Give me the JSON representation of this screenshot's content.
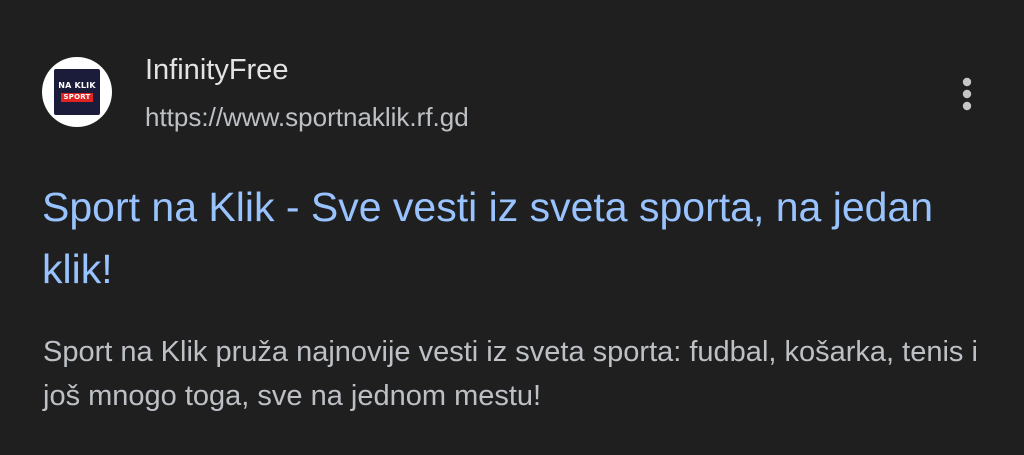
{
  "result": {
    "site_logo": {
      "line1": "NA KLIK",
      "line2": "SPORT",
      "background_color": "#1b1c3a",
      "badge_color": "#e02424"
    },
    "site_name": "InfinityFree",
    "url": "https://www.sportnaklik.rf.gd",
    "more_icon": "more-vert-icon",
    "title": "Sport na Klik - Sve vesti iz sveta sporta, na jedan klik!",
    "snippet": "Sport na Klik pruža najnovije vesti iz sveta sporta: fudbal, košarka, tenis i još mnogo toga, sve na jednom mestu!"
  },
  "colors": {
    "background": "#1f1f1f",
    "title_link": "#99c3ff",
    "text_primary": "#e3e3e3",
    "text_secondary": "#bdc1c6"
  }
}
